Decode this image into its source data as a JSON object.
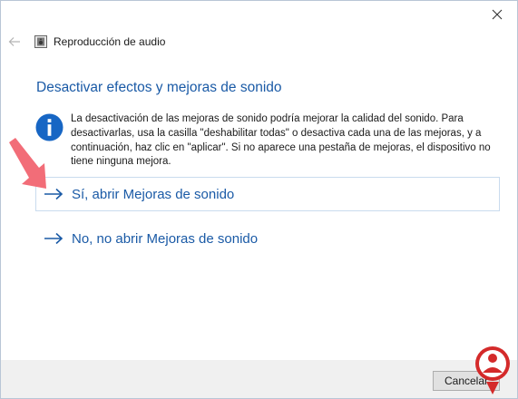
{
  "window": {
    "title": "Reproducción de audio",
    "icons": {
      "close": "close-icon",
      "back": "back-arrow-icon",
      "app": "speaker-icon"
    }
  },
  "content": {
    "heading": "Desactivar efectos y mejoras de sonido",
    "info_icon": "info-icon",
    "info_text": "La desactivación de las mejoras de sonido podría mejorar la calidad del sonido. Para desactivarlas, usa la casilla \"deshabilitar todas\" o desactiva cada una de las mejoras, y a continuación, haz clic en \"aplicar\". Si no aparece una pestaña de mejoras, el dispositivo no tiene ninguna mejora.",
    "options": [
      {
        "label": "Sí, abrir Mejoras de sonido",
        "icon": "arrow-right-icon",
        "highlighted": true
      },
      {
        "label": "No, no abrir Mejoras de sonido",
        "icon": "arrow-right-icon",
        "highlighted": false
      }
    ]
  },
  "annotation": {
    "icon": "pointer-arrow-icon",
    "color": "#f26d78"
  },
  "footer": {
    "cancel_label": "Cancelar"
  },
  "colors": {
    "accent": "#1a5aa6",
    "info_blue": "#1766c4",
    "option_border": "#c9dbee",
    "footer_bg": "#f0f0f0",
    "watermark_red": "#d42a2a"
  },
  "watermark": {
    "icon": "logo-icon"
  }
}
